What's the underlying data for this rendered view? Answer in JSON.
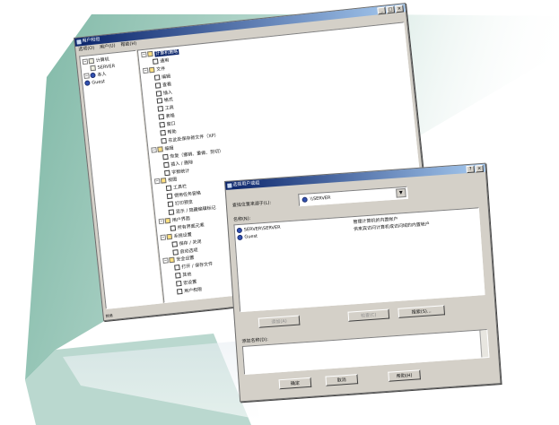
{
  "main_window": {
    "title": "用户和组",
    "menu": [
      "选项(O)",
      "用户(U)",
      "帮助(H)"
    ],
    "left_tree": [
      {
        "label": "计算机",
        "level": 0,
        "icon": "computer-icon",
        "expander": "−"
      },
      {
        "label": "SERVER",
        "level": 1,
        "icon": "server-icon",
        "expander": ""
      },
      {
        "label": "本人",
        "level": 0,
        "icon": "user-icon",
        "expander": "−"
      },
      {
        "label": "Guest",
        "level": 0,
        "icon": "guest-icon",
        "expander": ""
      }
    ],
    "right_tree": [
      {
        "label": "计算机策略",
        "level": 0,
        "expander": "−",
        "selected": true
      },
      {
        "label": "通用",
        "level": 1
      },
      {
        "label": "文件",
        "level": 0,
        "expander": "−"
      },
      {
        "label": "编辑",
        "level": 1
      },
      {
        "label": "查看",
        "level": 1
      },
      {
        "label": "插入",
        "level": 1
      },
      {
        "label": "格式",
        "level": 1
      },
      {
        "label": "工具",
        "level": 1
      },
      {
        "label": "表格",
        "level": 1
      },
      {
        "label": "窗口",
        "level": 1
      },
      {
        "label": "帮助",
        "level": 1
      },
      {
        "label": "在此处保存新文件（XP）",
        "level": 1
      },
      {
        "label": "编辑",
        "level": 0,
        "expander": "−"
      },
      {
        "label": "恢复（撤销、重做、剪切）",
        "level": 1
      },
      {
        "label": "插入 / 删除",
        "level": 1
      },
      {
        "label": "字数统计",
        "level": 1
      },
      {
        "label": "视图",
        "level": 0,
        "expander": "−"
      },
      {
        "label": "工具栏",
        "level": 1
      },
      {
        "label": "使用任务窗格",
        "level": 1
      },
      {
        "label": "打印预览",
        "level": 1
      },
      {
        "label": "显示 / 隐藏编辑标记",
        "level": 1
      },
      {
        "label": "用户界面",
        "level": 0,
        "expander": "−"
      },
      {
        "label": "所有界面元素",
        "level": 1
      },
      {
        "label": "系统设置",
        "level": 0,
        "expander": "−"
      },
      {
        "label": "保存 / 关闭",
        "level": 1
      },
      {
        "label": "启动选项",
        "level": 1
      },
      {
        "label": "安全设置",
        "level": 0,
        "expander": "−"
      },
      {
        "label": "打开 / 保存文件",
        "level": 1
      },
      {
        "label": "其他",
        "level": 1
      },
      {
        "label": "宏设置",
        "level": 1
      },
      {
        "label": "用户权限",
        "level": 1
      }
    ],
    "status": "就绪"
  },
  "dialog": {
    "title": "选择用户或组",
    "lookin_label": "查找位置来源于(L):",
    "lookin_value": "\\\\SERVER",
    "names_label": "名称(N):",
    "names": [
      {
        "name": "SERVER\\SERVER",
        "desc": "管理计算机的内置帐户"
      },
      {
        "name": "Guest",
        "desc": "供来宾访问计算机或访问域的内置帐户"
      }
    ],
    "add_button": "添加(A)",
    "check_button": "检查(C)",
    "search_button": "搜索(S)...",
    "added_label": "添加名称(D):",
    "added_value": "",
    "ok_button": "确定",
    "cancel_button": "取消",
    "help_button": "帮助(H)"
  }
}
